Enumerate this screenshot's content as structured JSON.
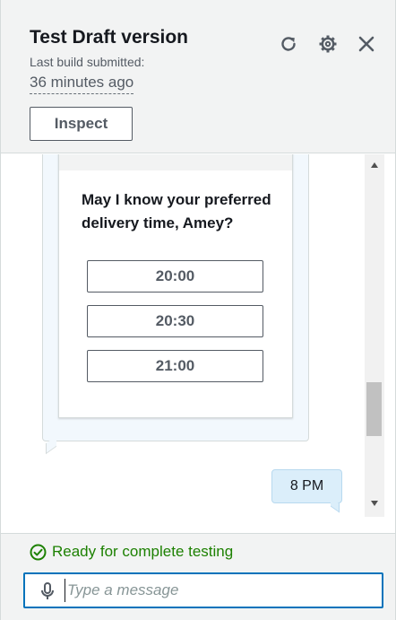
{
  "header": {
    "title": "Test Draft version",
    "build_label": "Last build submitted:",
    "build_time": "36 minutes ago",
    "inspect_label": "Inspect",
    "icons": [
      "refresh-icon",
      "gear-icon",
      "close-icon"
    ]
  },
  "chat": {
    "bot_question": "May I know your preferred delivery time, Amey?",
    "options": [
      "20:00",
      "20:30",
      "21:00"
    ],
    "user_message": "8 PM"
  },
  "footer": {
    "status": "Ready for complete testing",
    "status_color": "#1d8102",
    "input_placeholder": "Type a message",
    "input_value": ""
  },
  "colors": {
    "accent": "#0073bb",
    "header_bg": "#f2f3f3",
    "user_bubble": "#dbeefa"
  }
}
